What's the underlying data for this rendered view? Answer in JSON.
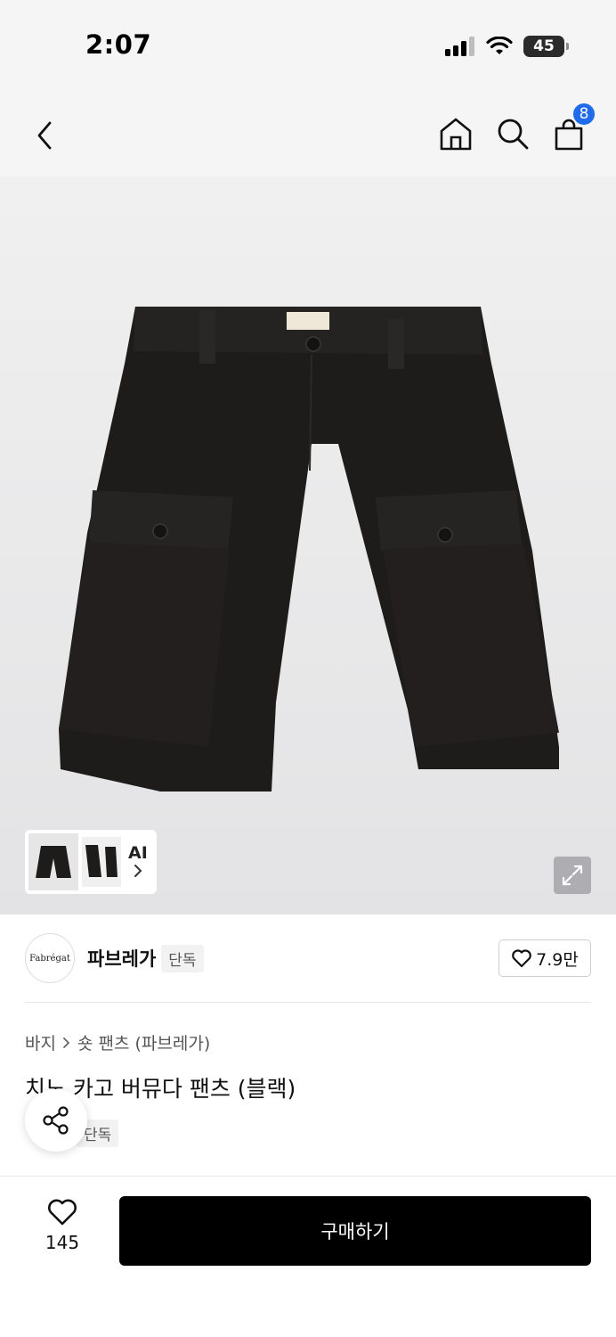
{
  "status_bar": {
    "time": "2:07",
    "battery": "45"
  },
  "nav": {
    "cart_count": "8"
  },
  "gallery": {
    "ai_label": "AI"
  },
  "brand": {
    "logo_text": "Fabrégat",
    "name": "파브레가",
    "exclusive_tag": "단독",
    "like_count": "7.9만"
  },
  "product": {
    "breadcrumb": [
      "바지",
      "숏 팬츠 (파브레가)"
    ],
    "title": "치노 카고 버뮤다 팬츠 (블랙)",
    "exclusive_tag": "단독"
  },
  "bottom_bar": {
    "wish_count": "145",
    "buy_label": "구매하기"
  },
  "icons": [
    "back-icon",
    "home-icon",
    "search-icon",
    "cart-icon",
    "expand-icon",
    "share-icon",
    "heart-icon",
    "chevron-right-icon"
  ],
  "colors": {
    "badge": "#1f6bf0",
    "buy_button": "#000000"
  }
}
